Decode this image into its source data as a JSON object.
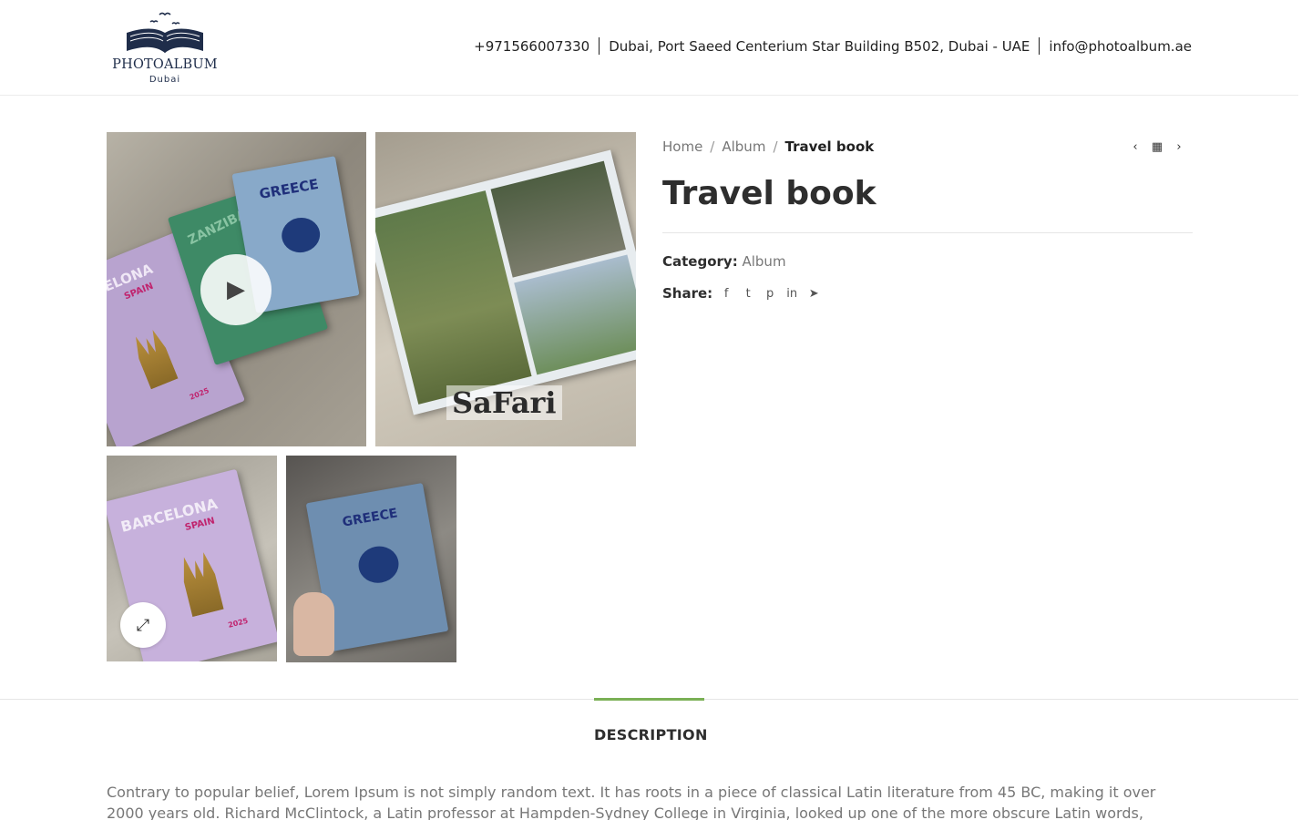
{
  "header": {
    "logo_name": "PHOTOALBUM",
    "logo_sub": "Dubai",
    "phone": "+971566007330",
    "address": "Dubai, Port Saeed Centerium Star Building B502, Dubai - UAE",
    "email": "info@photoalbum.ae"
  },
  "gallery": {
    "images": [
      {
        "books": [
          "BARCELONA",
          "SPAIN",
          "ZANZIBAR",
          "GREECE"
        ],
        "badge": "2025"
      },
      {
        "caption": "SaFari"
      },
      {
        "books": [
          "BARCELONA",
          "SPAIN"
        ],
        "badge": "2025"
      },
      {
        "books": [
          "GREECE"
        ]
      }
    ],
    "play_icon": "play-icon",
    "zoom_icon": "expand-icon"
  },
  "breadcrumb": {
    "home": "Home",
    "album": "Album",
    "current": "Travel book"
  },
  "product": {
    "title": "Travel book",
    "category_label": "Category:",
    "category_value": "Album",
    "share_label": "Share:"
  },
  "tabs": {
    "description": "DESCRIPTION"
  },
  "description": "Contrary to popular belief, Lorem Ipsum is not simply random text. It has roots in a piece of classical Latin literature from 45 BC, making it over 2000 years old. Richard McClintock, a Latin professor at Hampden-Sydney College in Virginia, looked up one of the more obscure Latin words, consectetur, from a Lorem",
  "colors": {
    "accent": "#7ab055",
    "text_dark": "#2e2e2e",
    "text_muted": "#777777"
  }
}
